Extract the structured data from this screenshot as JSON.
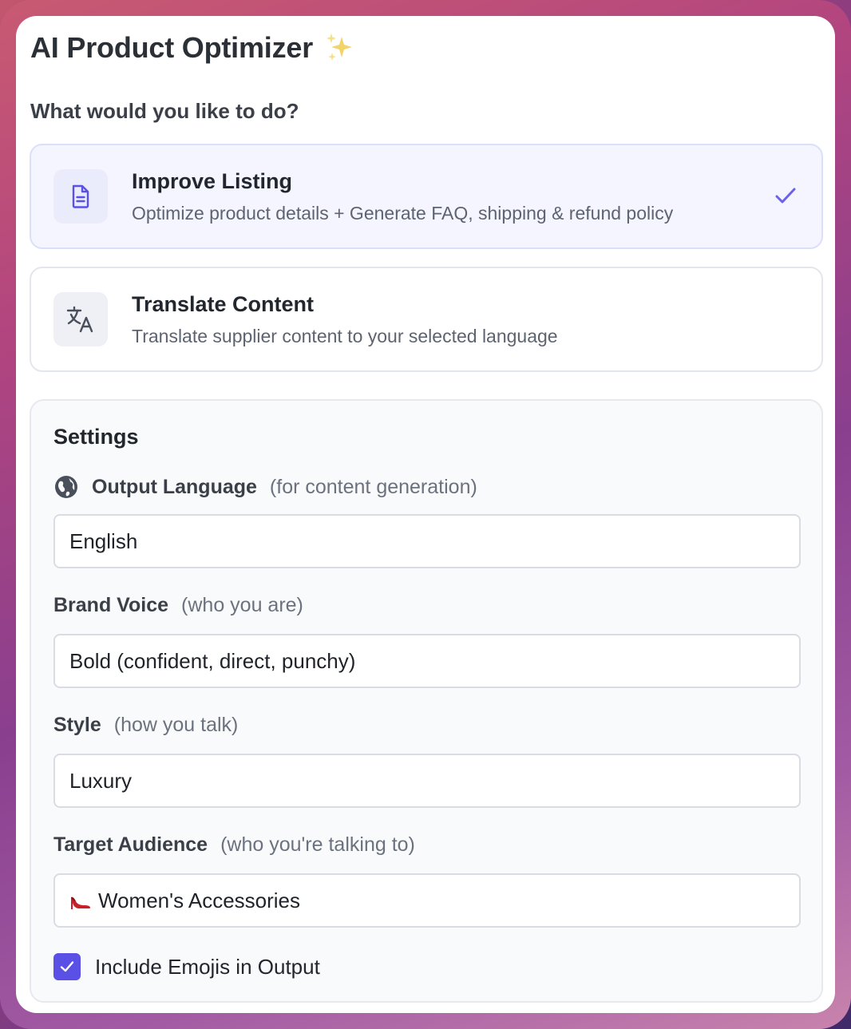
{
  "header": {
    "title": "AI Product Optimizer",
    "title_icon": "sparkles-icon"
  },
  "question": "What would you like to do?",
  "options": [
    {
      "title": "Improve Listing",
      "description": "Optimize product details + Generate FAQ, shipping & refund policy",
      "icon": "document-icon",
      "selected": true
    },
    {
      "title": "Translate Content",
      "description": "Translate supplier content to your selected language",
      "icon": "translate-icon",
      "selected": false
    }
  ],
  "settings": {
    "title": "Settings",
    "output_language": {
      "label": "Output Language",
      "hint": "(for content generation)",
      "value": "English",
      "icon": "globe-icon"
    },
    "brand_voice": {
      "label": "Brand Voice",
      "hint": "(who you are)",
      "value": "Bold (confident, direct, punchy)"
    },
    "style": {
      "label": "Style",
      "hint": "(how you talk)",
      "value": "Luxury"
    },
    "target_audience": {
      "label": "Target Audience",
      "hint": "(who you're talking to)",
      "value": "Women's Accessories",
      "icon": "high-heel-icon"
    },
    "include_emojis": {
      "label": "Include Emojis in Output",
      "checked": true
    }
  },
  "colors": {
    "accent": "#5b50e6",
    "selected_bg": "#f5f5ff"
  }
}
